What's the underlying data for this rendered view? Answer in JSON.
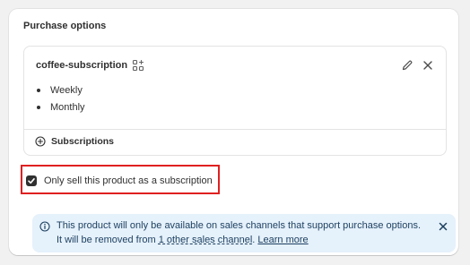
{
  "card": {
    "title": "Purchase options"
  },
  "plan": {
    "name": "coffee-subscription",
    "frequencies": [
      "Weekly",
      "Monthly"
    ],
    "footer_label": "Subscriptions"
  },
  "checkbox": {
    "label": "Only sell this product as a subscription",
    "checked": true
  },
  "banner": {
    "line1": "This product will only be available on sales channels that support purchase options.",
    "line2_prefix": "It will be removed from ",
    "channels_link": "1 other sales channel",
    "line2_sep": ". ",
    "learn_more": "Learn more"
  },
  "colors": {
    "highlight": "#e02020",
    "banner_bg": "#e5f1fb",
    "checkbox_fill": "#303030"
  },
  "icons": {
    "apps": "apps-icon",
    "edit": "pencil-icon",
    "close": "close-icon",
    "add": "plus-circle-icon",
    "info": "info-icon"
  }
}
